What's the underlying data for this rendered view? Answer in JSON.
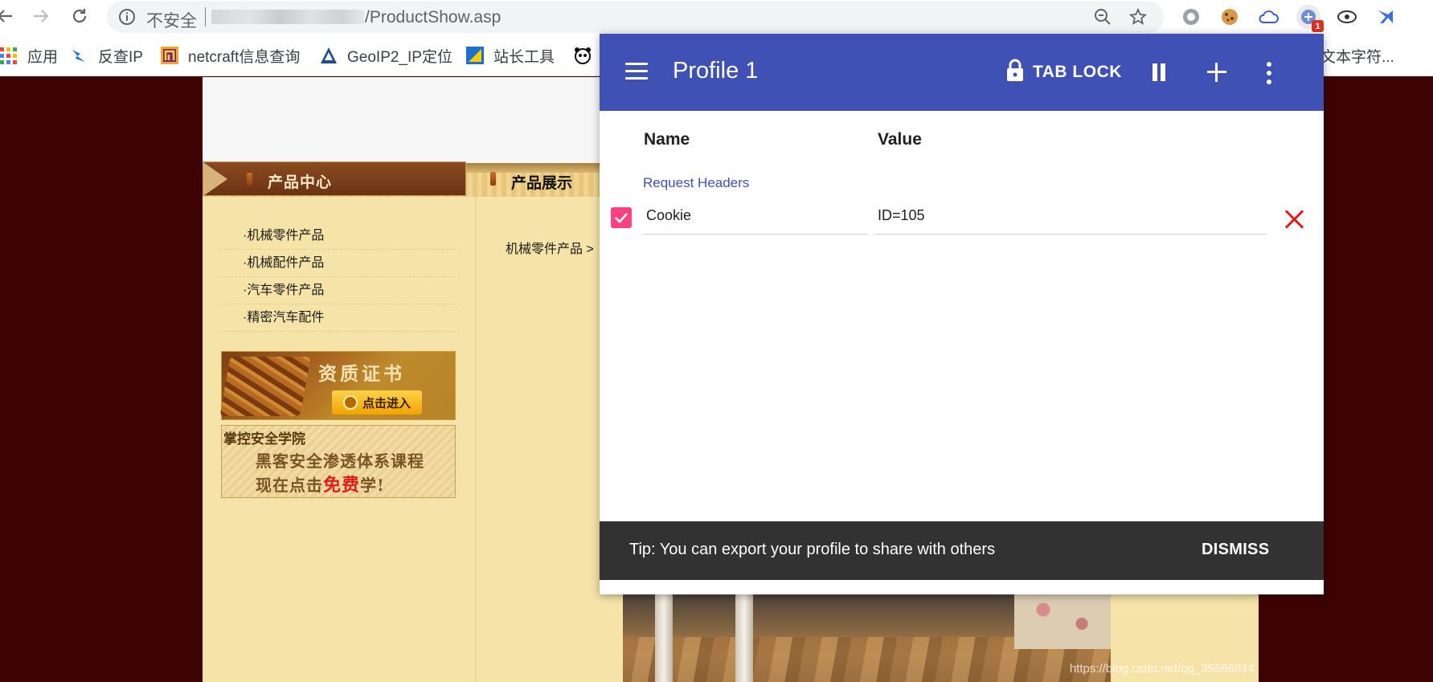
{
  "browser": {
    "insecure_label": "不安全",
    "url_path": "/ProductShow.asp",
    "extension_badge": "1"
  },
  "bookmarks": [
    {
      "label": "应用",
      "icon": "apps-grid-icon"
    },
    {
      "label": "反查IP",
      "icon": "bird-icon"
    },
    {
      "label": "netcraft信息查询",
      "icon": "netcraft-icon"
    },
    {
      "label": "GeoIP2_IP定位",
      "icon": "geoip-icon"
    },
    {
      "label": "站长工具",
      "icon": "chinaz-icon"
    },
    {
      "label": "文本字符...",
      "icon": "panda-icon"
    }
  ],
  "site": {
    "category_title": "产品中心",
    "categories": [
      "·机械零件产品",
      "·机械配件产品",
      "·汽车零件产品",
      "·精密汽车配件"
    ],
    "cert_title": "资质证书",
    "cert_button": "点击进入",
    "academy_title": "掌控安全学院",
    "academy_line1": "黑客安全渗透体系课程",
    "academy_line2_pre": "现在点击",
    "academy_line2_red": "免费",
    "academy_line2_post": "学!",
    "display_title": "产品展示",
    "breadcrumb": "机械零件产品 >",
    "watermark": "https://blog.csdn.net/qq_35569814"
  },
  "popup": {
    "profile_title": "Profile 1",
    "tab_lock_label": "TAB LOCK",
    "column_name": "Name",
    "column_value": "Value",
    "section_title": "Request Headers",
    "header_row": {
      "name": "Cookie",
      "value": "ID=105",
      "enabled": true
    },
    "snackbar_message": "Tip: You can export your profile to share with others",
    "snackbar_action": "DISMISS"
  },
  "colors": {
    "appbar": "#3f51b5",
    "accent": "#ff4081",
    "delete": "#e41c1c",
    "snackbar": "#323232"
  }
}
